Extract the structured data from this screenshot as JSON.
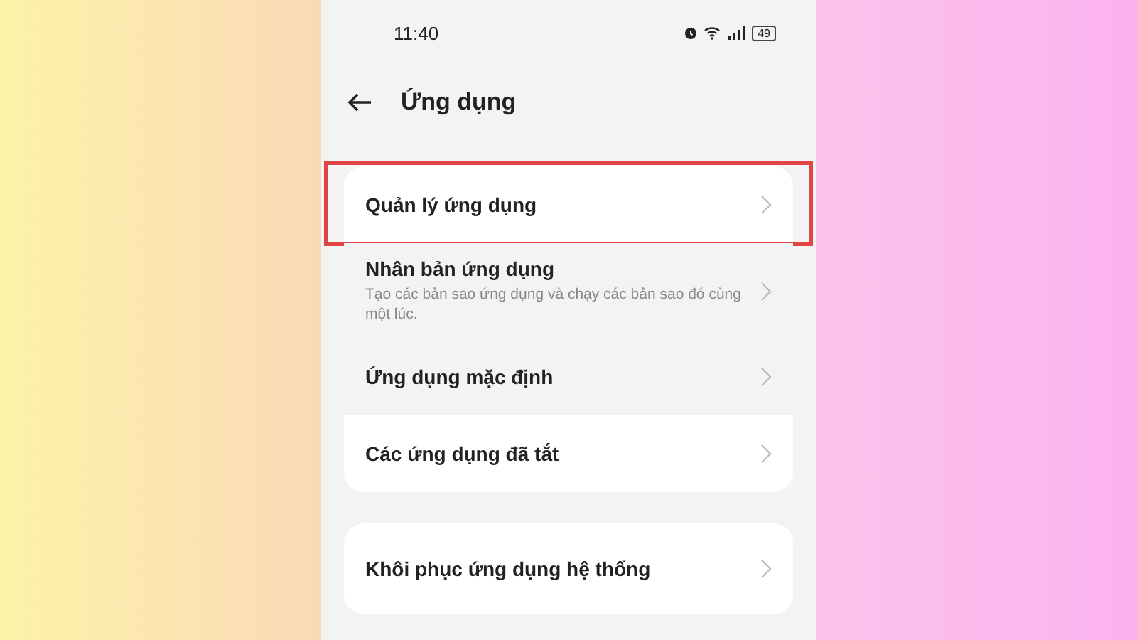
{
  "status_bar": {
    "time": "11:40",
    "battery": "49"
  },
  "header": {
    "title": "Ứng dụng"
  },
  "groups": [
    {
      "items": [
        {
          "title": "Quản lý ứng dụng",
          "highlighted": true,
          "shaded": false
        },
        {
          "title": "Nhân bản ứng dụng",
          "subtitle": "Tạo các bản sao ứng dụng và chạy các bản sao đó cùng một lúc.",
          "highlighted": false,
          "shaded": true
        },
        {
          "title": "Ứng dụng mặc định",
          "highlighted": false,
          "shaded": true
        },
        {
          "title": "Các ứng dụng đã tắt",
          "highlighted": false,
          "shaded": false
        }
      ]
    },
    {
      "items": [
        {
          "title": "Khôi phục ứng dụng hệ thống",
          "highlighted": false,
          "shaded": false
        }
      ]
    }
  ]
}
